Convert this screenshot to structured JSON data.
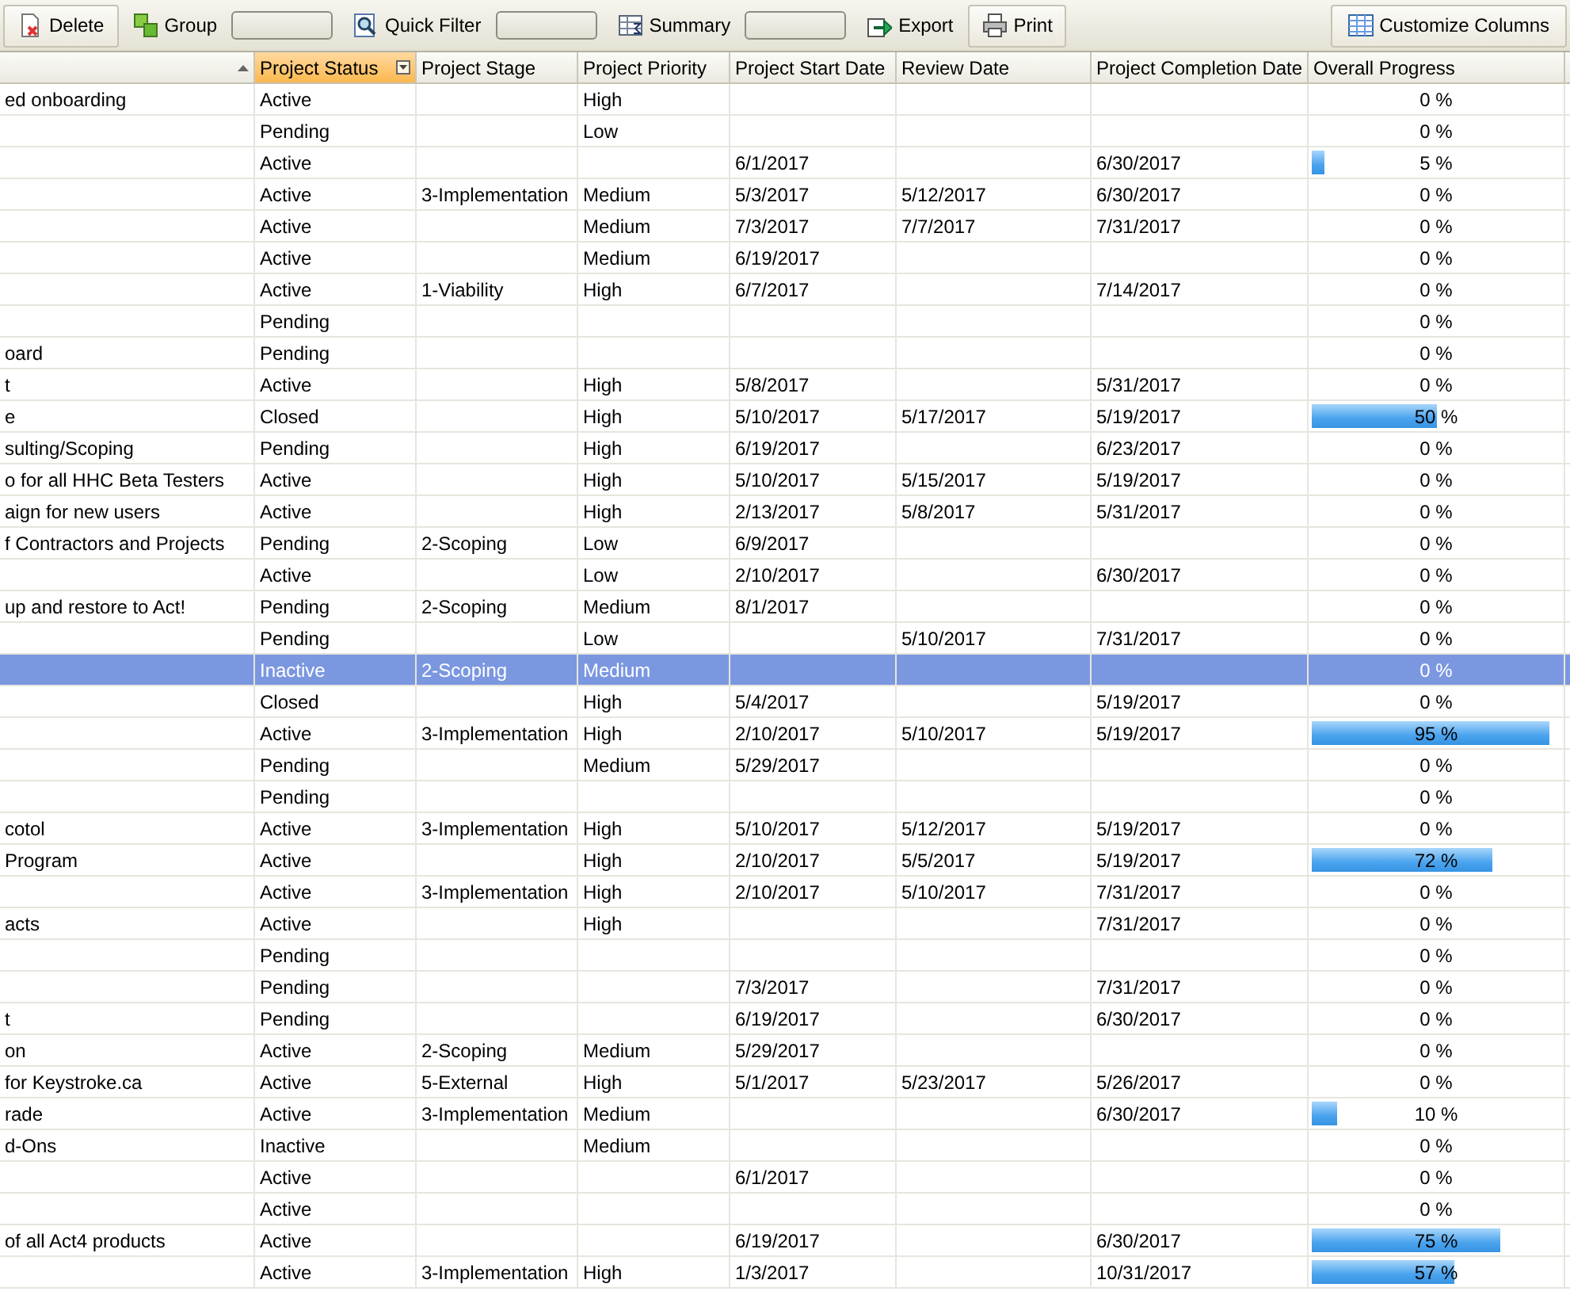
{
  "toolbar": {
    "items": [
      {
        "kind": "button",
        "label": "Delete"
      },
      {
        "kind": "tool-field",
        "label": "Group"
      },
      {
        "kind": "tool-field",
        "label": "Quick Filter"
      },
      {
        "kind": "tool-field",
        "label": "Summary"
      },
      {
        "kind": "tool",
        "label": "Export"
      },
      {
        "kind": "button",
        "label": "Print"
      }
    ],
    "right_button": {
      "label": "Customize Columns"
    }
  },
  "table": {
    "columns": [
      {
        "selected": false,
        "sorted": true
      },
      {
        "label": "Project Status",
        "selected": true,
        "filter": true
      },
      {
        "label": "Project Stage",
        "selected": false
      },
      {
        "label": "Project Priority",
        "selected": false
      },
      {
        "label": "Project Start Date",
        "selected": false
      },
      {
        "label": "Review Date",
        "selected": false
      },
      {
        "label": "Project Completion Date",
        "selected": false
      },
      {
        "label": "Overall Progress",
        "selected": false
      }
    ],
    "rows": [
      {
        "selected": false,
        "column_1": "ed onboarding",
        "status": "Active",
        "priority": "High",
        "progress": {
          "reading": "0 %"
        }
      },
      {
        "selected": false,
        "status": "Pending",
        "priority": "Low",
        "progress": {
          "reading": "0 %"
        }
      },
      {
        "selected": false,
        "status": "Active",
        "start": "6/1/2017",
        "completion": "6/30/2017",
        "progress": {
          "level": 0.05,
          "reading": "5 %"
        }
      },
      {
        "selected": false,
        "status": "Active",
        "stage": "3-Implementation",
        "priority": "Medium",
        "start": "5/3/2017",
        "review": "5/12/2017",
        "completion": "6/30/2017",
        "progress": {
          "reading": "0 %"
        }
      },
      {
        "selected": false,
        "status": "Active",
        "priority": "Medium",
        "start": "7/3/2017",
        "review": "7/7/2017",
        "completion": "7/31/2017",
        "progress": {
          "reading": "0 %"
        }
      },
      {
        "selected": false,
        "status": "Active",
        "priority": "Medium",
        "start": "6/19/2017",
        "progress": {
          "reading": "0 %"
        }
      },
      {
        "selected": false,
        "status": "Active",
        "stage": "1-Viability",
        "priority": "High",
        "start": "6/7/2017",
        "completion": "7/14/2017",
        "progress": {
          "reading": "0 %"
        }
      },
      {
        "selected": false,
        "status": "Pending",
        "progress": {
          "reading": "0 %"
        }
      },
      {
        "selected": false,
        "column_1": "oard",
        "status": "Pending",
        "progress": {
          "reading": "0 %"
        }
      },
      {
        "selected": false,
        "column_1": "t",
        "status": "Active",
        "priority": "High",
        "start": "5/8/2017",
        "completion": "5/31/2017",
        "progress": {
          "reading": "0 %"
        }
      },
      {
        "selected": false,
        "column_1": "e",
        "status": "Closed",
        "priority": "High",
        "start": "5/10/2017",
        "review": "5/17/2017",
        "completion": "5/19/2017",
        "progress": {
          "level": 0.5,
          "reading": "50 %"
        }
      },
      {
        "selected": false,
        "column_1": "sulting/Scoping",
        "status": "Pending",
        "priority": "High",
        "start": "6/19/2017",
        "completion": "6/23/2017",
        "progress": {
          "reading": "0 %"
        }
      },
      {
        "selected": false,
        "column_1": "o for all HHC Beta Testers",
        "status": "Active",
        "priority": "High",
        "start": "5/10/2017",
        "review": "5/15/2017",
        "completion": "5/19/2017",
        "progress": {
          "reading": "0 %"
        }
      },
      {
        "selected": false,
        "column_1": "aign for new users",
        "status": "Active",
        "priority": "High",
        "start": "2/13/2017",
        "review": "5/8/2017",
        "completion": "5/31/2017",
        "progress": {
          "reading": "0 %"
        }
      },
      {
        "selected": false,
        "column_1": "f Contractors and Projects",
        "status": "Pending",
        "stage": "2-Scoping",
        "priority": "Low",
        "start": "6/9/2017",
        "progress": {
          "reading": "0 %"
        }
      },
      {
        "selected": false,
        "status": "Active",
        "priority": "Low",
        "start": "2/10/2017",
        "completion": "6/30/2017",
        "progress": {
          "reading": "0 %"
        }
      },
      {
        "selected": false,
        "column_1": "up and restore to Act!",
        "status": "Pending",
        "stage": "2-Scoping",
        "priority": "Medium",
        "start": "8/1/2017",
        "progress": {
          "reading": "0 %"
        }
      },
      {
        "selected": false,
        "status": "Pending",
        "priority": "Low",
        "review": "5/10/2017",
        "completion": "7/31/2017",
        "progress": {
          "reading": "0 %"
        }
      },
      {
        "selected": true,
        "status": "Inactive",
        "stage": "2-Scoping",
        "priority": "Medium",
        "progress": {
          "reading": "0 %"
        }
      },
      {
        "selected": false,
        "status": "Closed",
        "priority": "High",
        "start": "5/4/2017",
        "completion": "5/19/2017",
        "progress": {
          "reading": "0 %"
        }
      },
      {
        "selected": false,
        "status": "Active",
        "stage": "3-Implementation",
        "priority": "High",
        "start": "2/10/2017",
        "review": "5/10/2017",
        "completion": "5/19/2017",
        "progress": {
          "level": 0.95,
          "reading": "95 %"
        }
      },
      {
        "selected": false,
        "status": "Pending",
        "priority": "Medium",
        "start": "5/29/2017",
        "progress": {
          "reading": "0 %"
        }
      },
      {
        "selected": false,
        "status": "Pending",
        "progress": {
          "reading": "0 %"
        }
      },
      {
        "selected": false,
        "column_1": "cotol",
        "status": "Active",
        "stage": "3-Implementation",
        "priority": "High",
        "start": "5/10/2017",
        "review": "5/12/2017",
        "completion": "5/19/2017",
        "progress": {
          "reading": "0 %"
        }
      },
      {
        "selected": false,
        "column_1": "Program",
        "status": "Active",
        "priority": "High",
        "start": "2/10/2017",
        "review": "5/5/2017",
        "completion": "5/19/2017",
        "progress": {
          "level": 0.72,
          "reading": "72 %"
        }
      },
      {
        "selected": false,
        "status": "Active",
        "stage": "3-Implementation",
        "priority": "High",
        "start": "2/10/2017",
        "review": "5/10/2017",
        "completion": "7/31/2017",
        "progress": {
          "reading": "0 %"
        }
      },
      {
        "selected": false,
        "column_1": "acts",
        "status": "Active",
        "priority": "High",
        "completion": "7/31/2017",
        "progress": {
          "reading": "0 %"
        }
      },
      {
        "selected": false,
        "status": "Pending",
        "progress": {
          "reading": "0 %"
        }
      },
      {
        "selected": false,
        "status": "Pending",
        "start": "7/3/2017",
        "completion": "7/31/2017",
        "progress": {
          "reading": "0 %"
        }
      },
      {
        "selected": false,
        "column_1": "t",
        "status": "Pending",
        "start": "6/19/2017",
        "completion": "6/30/2017",
        "progress": {
          "reading": "0 %"
        }
      },
      {
        "selected": false,
        "column_1": "on",
        "status": "Active",
        "stage": "2-Scoping",
        "priority": "Medium",
        "start": "5/29/2017",
        "progress": {
          "reading": "0 %"
        }
      },
      {
        "selected": false,
        "column_1": "for Keystroke.ca",
        "status": "Active",
        "stage": "5-External",
        "priority": "High",
        "start": "5/1/2017",
        "review": "5/23/2017",
        "completion": "5/26/2017",
        "progress": {
          "reading": "0 %"
        }
      },
      {
        "selected": false,
        "column_1": "rade",
        "status": "Active",
        "stage": "3-Implementation",
        "priority": "Medium",
        "completion": "6/30/2017",
        "progress": {
          "level": 0.1,
          "reading": "10 %"
        }
      },
      {
        "selected": false,
        "column_1": "d-Ons",
        "status": "Inactive",
        "priority": "Medium",
        "progress": {
          "reading": "0 %"
        }
      },
      {
        "selected": false,
        "status": "Active",
        "start": "6/1/2017",
        "progress": {
          "reading": "0 %"
        }
      },
      {
        "selected": false,
        "status": "Active",
        "progress": {
          "reading": "0 %"
        }
      },
      {
        "selected": false,
        "column_1": "of all Act4 products",
        "status": "Active",
        "start": "6/19/2017",
        "completion": "6/30/2017",
        "progress": {
          "level": 0.75,
          "reading": "75 %"
        }
      },
      {
        "selected": false,
        "status": "Active",
        "stage": "3-Implementation",
        "priority": "High",
        "start": "1/3/2017",
        "completion": "10/31/2017",
        "progress": {
          "level": 0.57,
          "reading": "57 %"
        }
      }
    ]
  }
}
